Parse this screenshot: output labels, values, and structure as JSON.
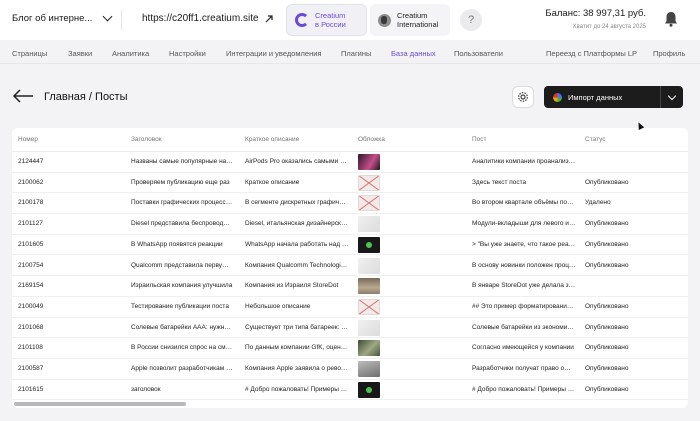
{
  "header": {
    "site_name": "Блог об интерне...",
    "site_url": "https://c20ff1.creatium.site",
    "creatium_ru": {
      "line1": "Creatium",
      "line2": "в России"
    },
    "creatium_int": {
      "line1": "Creatium",
      "line2": "International"
    },
    "help": "?",
    "balance": "Баланс: 38 997,31 руб.",
    "balance_note": "Хватит до 24 августа 2025"
  },
  "nav": [
    "Страницы",
    "Заявки",
    "Аналитика",
    "Настройки",
    "Интеграции и уведомления",
    "Плагины",
    "База данных",
    "Пользователи",
    "Переезд с Платформы LP",
    "Профиль"
  ],
  "nav_active": "База данных",
  "page": {
    "title": "Главная / Посты",
    "import_label": "Импорт данных"
  },
  "table": {
    "columns": [
      "Номер",
      "Заголовок",
      "Краткое описание",
      "Обложка",
      "Пост",
      "Статус"
    ],
    "rows": [
      {
        "num": "2124447",
        "title": "Названы самые популярные наушники",
        "desc": "AirPods Pro оказались самыми востребованными",
        "cover": "pink",
        "post": "Аналитики компании проанализировали",
        "status": ""
      },
      {
        "num": "2100062",
        "title": "Проверяем публикацию еще раз",
        "desc": "Краткое описание",
        "cover": "broken",
        "post": "Здесь текст поста",
        "status": "Опубликовано"
      },
      {
        "num": "2100178",
        "title": "Поставки графических процессоров",
        "desc": "В сегменте дискретных графических ускорителей",
        "cover": "broken",
        "post": "Во втором квартале объёмы поставок",
        "status": "Удалено"
      },
      {
        "num": "2101127",
        "title": "Diesel представила беспроводные наушники",
        "desc": "Diesel, итальянская дизайнерская компания",
        "cover": "light",
        "post": "Модули-вкладыши для левого и правого уха",
        "status": "Опубликовано"
      },
      {
        "num": "2101605",
        "title": "В WhatsApp появятся реакции",
        "desc": "WhatsApp начала работать над реакциями",
        "cover": "dark",
        "post": "> \"Вы уже знаете, что такое реакции\"",
        "status": "Опубликовано"
      },
      {
        "num": "2100754",
        "title": "Qualcomm представила первую в мире",
        "desc": "Компания Qualcomm Technologies представила",
        "cover": "light",
        "post": "В основу новинки положен процессор",
        "status": "Опубликовано"
      },
      {
        "num": "2169154",
        "title": "Израильская компания улучшила",
        "desc": "Компания из Израиля StoreDot",
        "cover": "street",
        "post": "В январе StoreDot уже делала заявление",
        "status": ""
      },
      {
        "num": "2100049",
        "title": "Тестирование публикации поста",
        "desc": "Небольшое описание",
        "cover": "broken",
        "post": "## Это пример форматирования текста",
        "status": "Опубликовано"
      },
      {
        "num": "2101068",
        "title": "Солевые батарейки ААА: нужно ли",
        "desc": "Существует три типа батареек: солевые",
        "cover": "light",
        "post": "Солевые батарейки из экономичного",
        "status": "Опубликовано"
      },
      {
        "num": "2101108",
        "title": "В России снизился спрос на смартфоны",
        "desc": "По данным компании GfK, оценивающей",
        "cover": "green",
        "post": "Согласно имеющейся у компании",
        "status": "Опубликовано"
      },
      {
        "num": "2100587",
        "title": "Apple позволит разработчикам публиковать",
        "desc": "Компания Apple заявила о революционных",
        "cover": "grey",
        "post": "Разработчики получат право оформлять",
        "status": "Опубликовано"
      },
      {
        "num": "2101615",
        "title": "заголовок",
        "desc": "# Добро пожаловать! Примеры заголовков",
        "cover": "dark",
        "post": "# Добро пожаловать! Примеры заголовков",
        "status": "Опубликовано"
      }
    ]
  }
}
